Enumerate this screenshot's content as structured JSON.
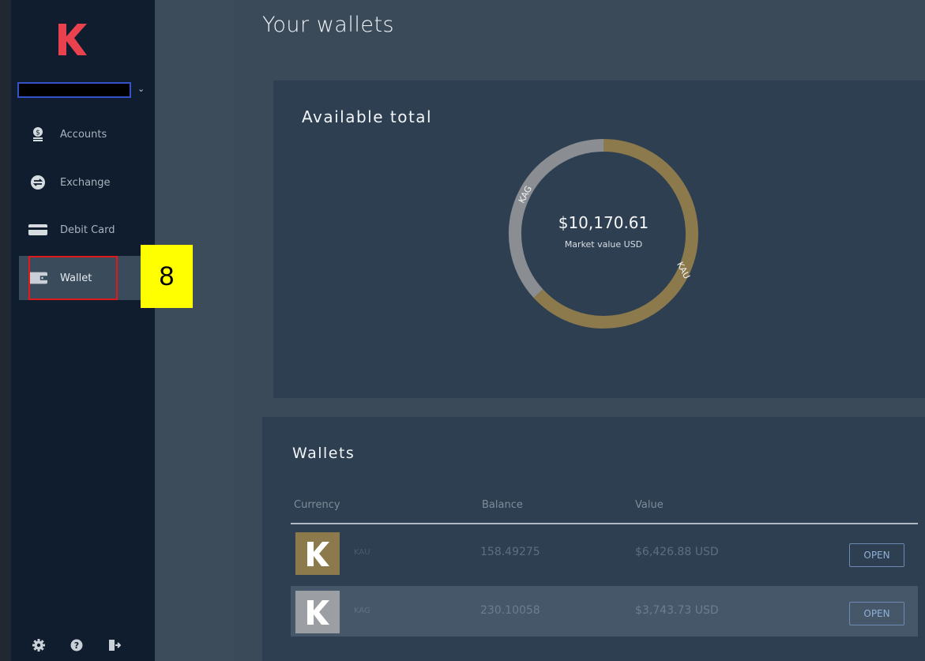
{
  "app": {
    "logo_letter": "K",
    "brand_color": "#e9424e"
  },
  "account_selector": {
    "value": ""
  },
  "sidebar": {
    "items": [
      {
        "label": "Accounts",
        "icon": "accounts-icon",
        "active": false
      },
      {
        "label": "Exchange",
        "icon": "exchange-icon",
        "active": false
      },
      {
        "label": "Debit Card",
        "icon": "debit-card-icon",
        "active": false
      },
      {
        "label": "Wallet",
        "icon": "wallet-icon",
        "active": true
      }
    ],
    "bottom_icons": [
      "settings-icon",
      "help-icon",
      "logout-icon"
    ]
  },
  "annotation": {
    "step_number": "8",
    "highlight_color": "#e01a1a",
    "badge_color": "#ffff00"
  },
  "page": {
    "title": "Your wallets"
  },
  "total_card": {
    "title": "Available total",
    "amount": "$10,170.61",
    "subtitle": "Market value USD",
    "segments": [
      {
        "label": "KAG",
        "color": "#8a8e92"
      },
      {
        "label": "KAU",
        "color": "#8c7a4c"
      }
    ]
  },
  "chart_data": {
    "type": "pie",
    "title": "Available total",
    "categories": [
      "KAU",
      "KAG"
    ],
    "values": [
      6426.88,
      3743.73
    ],
    "colors": [
      "#8c7a4c",
      "#8a8e92"
    ],
    "center_label": "$10,170.61",
    "center_sublabel": "Market value USD"
  },
  "wallets": {
    "title": "Wallets",
    "columns": [
      "Currency",
      "Balance",
      "Value"
    ],
    "rows": [
      {
        "currency": "KAU",
        "balance": "158.49275",
        "value": "$6,426.88 USD",
        "action": "OPEN",
        "coin_color": "#8c7a4c"
      },
      {
        "currency": "KAG",
        "balance": "230.10058",
        "value": "$3,743.73 USD",
        "action": "OPEN",
        "coin_color": "#9b9ea2"
      }
    ]
  },
  "colors": {
    "sidebar_bg": "#0f1d2e",
    "page_bg": "#3b4a59",
    "card_bg": "#2e3f51",
    "kau_gold": "#8c7a4c",
    "kag_silver": "#8a8e92"
  }
}
